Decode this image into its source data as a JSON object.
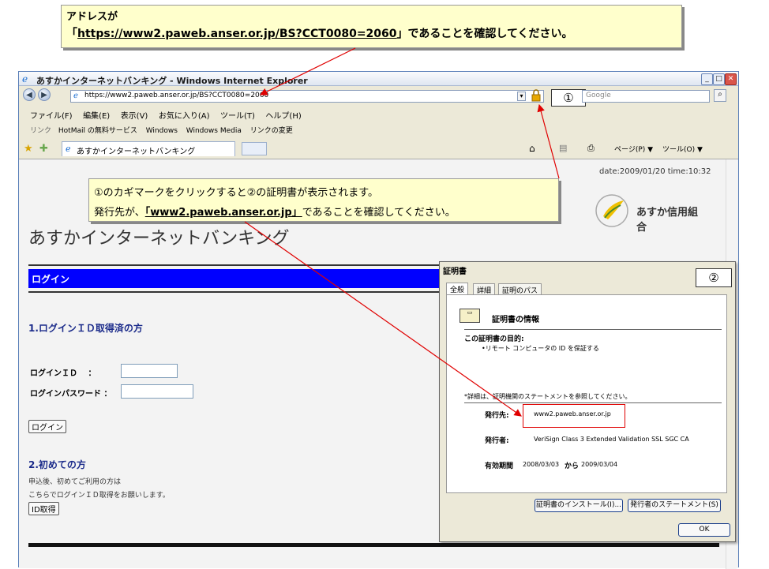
{
  "callout_top": {
    "line1": "アドレスが",
    "url": "https://www2.paweb.anser.or.jp/BS?CCT0080=2060",
    "prefix": "「",
    "suffix": "」であることを確認してください。"
  },
  "browser": {
    "title": "あすかインターネットバンキング - Windows Internet Explorer",
    "address": "https://www2.paweb.anser.or.jp/BS?CCT0080=2060",
    "search_placeholder": "Google",
    "marker1": "①",
    "menu": [
      "ファイル(F)",
      "編集(E)",
      "表示(V)",
      "お気に入り(A)",
      "ツール(T)",
      "ヘルプ(H)"
    ],
    "links": [
      "リンク",
      "HotMail の無料サービス",
      "Windows",
      "Windows Media",
      "リンクの変更"
    ],
    "tab": "あすかインターネットバンキング",
    "toolbar_right": [
      "ページ(P) ▼",
      "ツール(O) ▼"
    ]
  },
  "page": {
    "date": "date:2009/01/20 time:10:32",
    "bank_name": "あすか信用組合",
    "heading": "あすかインターネットバンキング",
    "login_bar": "ログイン",
    "section1": "1.ログインＩＤ取得済の方",
    "id_label": "ログインＩＤ　 ：",
    "pw_label": "ログインパスワード ：",
    "login_btn": "ログイン",
    "section2": "2.初めての方",
    "info1": "申込後、初めてご利用の方は",
    "info2": "こちらでログインＩＤ取得をお願いします。",
    "id_btn": "ID取得"
  },
  "callout_mid": {
    "line1": "①のカギマークをクリックすると②の証明書が表示されます。",
    "line2_pre": "発行先が、",
    "line2_url": "「www2.paweb.anser.or.jp」",
    "line2_post": "であることを確認してください。"
  },
  "cert": {
    "title": "証明書",
    "marker2": "②",
    "tabs": [
      "全般",
      "詳細",
      "証明のパス"
    ],
    "info_title": "証明書の情報",
    "purpose_label": "この証明書の目的:",
    "purpose_item": "•リモート コンピュータの ID を保証する",
    "note": "*詳細は、証明機関のステートメントを参照してください。",
    "issued_to_label": "発行先:",
    "issued_to": "www2.paweb.anser.or.jp",
    "issued_by_label": "発行者:",
    "issued_by": "VeriSign Class 3 Extended Validation SSL SGC CA",
    "validity_label": "有効期間",
    "valid_from": "2008/03/03",
    "valid_to_word": "から",
    "valid_to": "2009/03/04",
    "install_btn": "証明書のインストール(I)...",
    "statement_btn": "発行者のステートメント(S)",
    "ok_btn": "OK"
  },
  "colors": {
    "accent_blue": "#0000ff",
    "callout_bg": "#ffffcc",
    "arrow": "#e00000"
  }
}
